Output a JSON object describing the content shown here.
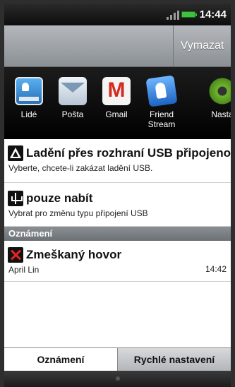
{
  "status_bar": {
    "time": "14:44",
    "signal_icon": "signal-bars-icon",
    "battery_icon": "battery-icon",
    "battery_color": "#40c040"
  },
  "title_bar": {
    "clear_label": "Vymazat"
  },
  "apps": [
    {
      "label": "Lidé",
      "icon": "people-icon"
    },
    {
      "label": "Pošta",
      "icon": "mail-icon"
    },
    {
      "label": "Gmail",
      "icon": "gmail-icon"
    },
    {
      "label_line1": "Friend",
      "label_line2": "Stream",
      "icon": "friend-stream-icon"
    },
    {
      "label": "Nasta",
      "icon": "settings-icon"
    }
  ],
  "notifications": {
    "usb_debug": {
      "title": "Ladění přes rozhraní USB připojeno",
      "subtitle": "Vyberte, chcete-li zakázat ladění USB.",
      "icon": "warning-icon"
    },
    "usb_charge": {
      "title": "pouze nabít",
      "subtitle": "Vybrat pro změnu typu připojení USB",
      "icon": "usb-icon"
    },
    "section_title": "Oznámení",
    "missed_call": {
      "title": "Zmeškaný hovor",
      "caller": "April Lin",
      "time": "14:42",
      "icon": "missed-call-icon",
      "icon_color": "#e8231e"
    }
  },
  "tabs": {
    "notifications": "Oznámení",
    "quick_settings": "Rychlé nastavení"
  }
}
